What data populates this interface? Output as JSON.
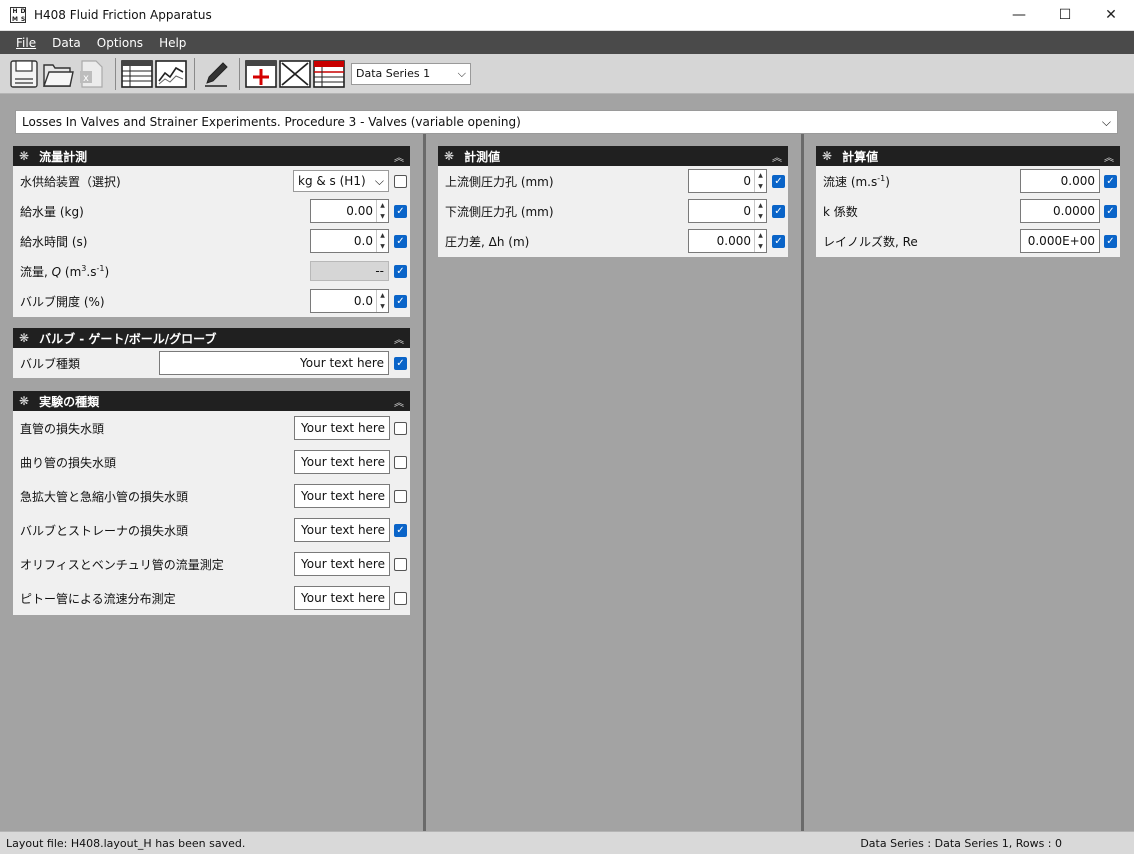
{
  "window": {
    "title": "H408 Fluid Friction Apparatus",
    "app_icon_letters": [
      "H",
      "D",
      "M",
      "S"
    ],
    "minimize": "—",
    "maximize": "☐",
    "close": "✕"
  },
  "menu": {
    "file": "File",
    "data": "Data",
    "options": "Options",
    "help": "Help"
  },
  "toolbar": {
    "series_selected": "Data Series 1"
  },
  "procedure": {
    "selected": "Losses In Valves and Strainer Experiments. Procedure 3 - Valves (variable opening)"
  },
  "panels": {
    "flow": {
      "title": "流量計測",
      "rows": [
        {
          "label": "水供給装置（選択)",
          "value": "kg & s (H1)",
          "checked": false
        },
        {
          "label": "給水量 (kg)",
          "value": "0.00",
          "checked": true
        },
        {
          "label": "給水時間 (s)",
          "value": "0.0",
          "checked": true
        },
        {
          "label_pre": "流量, ",
          "label_var": "Q",
          "label_unit": " (m",
          "label_sup": "3",
          "label_mid": ".s",
          "label_sup2": "-1",
          "label_end": ")",
          "value": "--",
          "checked": true
        },
        {
          "label": "バルブ開度 (%)",
          "value": "0.0",
          "checked": true
        }
      ]
    },
    "valve": {
      "title": "バルブ - ゲート/ボール/グローブ",
      "rows": [
        {
          "label": "バルブ種類",
          "value": "Your text here",
          "checked": true
        }
      ]
    },
    "experiment": {
      "title": "実験の種類",
      "rows": [
        {
          "label": "直管の損失水頭",
          "value": "Your text here",
          "checked": false
        },
        {
          "label": "曲り管の損失水頭",
          "value": "Your text here",
          "checked": false
        },
        {
          "label": "急拡大管と急縮小管の損失水頭",
          "value": "Your text here",
          "checked": false
        },
        {
          "label": "バルブとストレーナの損失水頭",
          "value": "Your text here",
          "checked": true
        },
        {
          "label": "オリフィスとベンチュリ管の流量測定",
          "value": "Your text here",
          "checked": false
        },
        {
          "label": "ピトー管による流速分布測定",
          "value": "Your text here",
          "checked": false
        }
      ]
    },
    "measured": {
      "title": "計測値",
      "rows": [
        {
          "label": "上流側圧力孔 (mm)",
          "value": "0",
          "checked": true
        },
        {
          "label": "下流側圧力孔 (mm)",
          "value": "0",
          "checked": true
        },
        {
          "label": "圧力差, Δh (m)",
          "value": "0.000",
          "checked": true
        }
      ]
    },
    "calculated": {
      "title": "計算値",
      "rows": [
        {
          "label_pre": "流速 (m.s",
          "label_sup": "-1",
          "label_end": ")",
          "value": "0.000",
          "checked": true
        },
        {
          "label": "k 係数",
          "value": "0.0000",
          "checked": true
        },
        {
          "label": "レイノルズ数, Re",
          "value": "0.000E+00",
          "checked": true
        }
      ]
    }
  },
  "status": {
    "left": "Layout file: H408.layout_H has been saved.",
    "right": "Data Series : Data Series 1,  Rows : 0"
  },
  "icons": {
    "gear": "❋",
    "collapse": "︽",
    "spin_up": "▲",
    "spin_down": "▼",
    "dropdown": "⌵",
    "check": "✓"
  },
  "colors": {
    "menubar": "#4a4a4a",
    "panel_header": "#202020",
    "checkbox_on": "#0a64c8",
    "background": "#a3a3a3"
  }
}
